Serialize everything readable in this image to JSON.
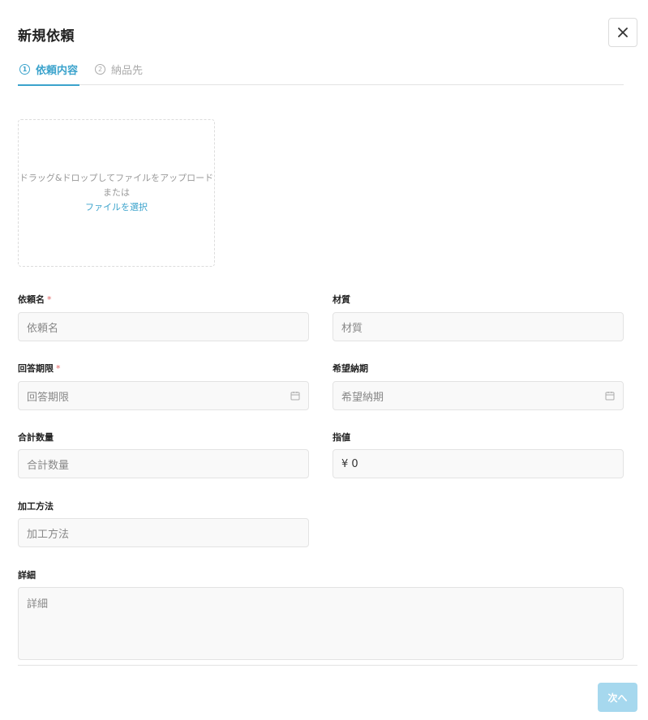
{
  "dialog": {
    "title": "新規依頼"
  },
  "tabs": [
    {
      "number": "1",
      "label": "依頼内容",
      "active": true
    },
    {
      "number": "2",
      "label": "納品先",
      "active": false
    }
  ],
  "upload": {
    "line1": "ドラッグ&ドロップしてファイルをアップロード",
    "line2": "または",
    "link": "ファイルを選択"
  },
  "fields": {
    "request_name": {
      "label": "依頼名",
      "placeholder": "依頼名",
      "required": "*"
    },
    "material": {
      "label": "材質",
      "placeholder": "材質"
    },
    "answer_deadline": {
      "label": "回答期限",
      "placeholder": "回答期限",
      "required": "*"
    },
    "desired_delivery": {
      "label": "希望納期",
      "placeholder": "希望納期"
    },
    "total_quantity": {
      "label": "合計数量",
      "placeholder": "合計数量"
    },
    "target_price": {
      "label": "指値",
      "value": "¥ 0"
    },
    "processing_method": {
      "label": "加工方法",
      "placeholder": "加工方法"
    },
    "details": {
      "label": "詳細",
      "placeholder": "詳細"
    }
  },
  "footer": {
    "next_label": "次へ"
  },
  "colors": {
    "accent": "#3ba3cc",
    "button_disabled": "#a6d8ee",
    "required": "#e06666"
  },
  "icons": {
    "close": "close-icon",
    "calendar": "calendar-icon"
  }
}
